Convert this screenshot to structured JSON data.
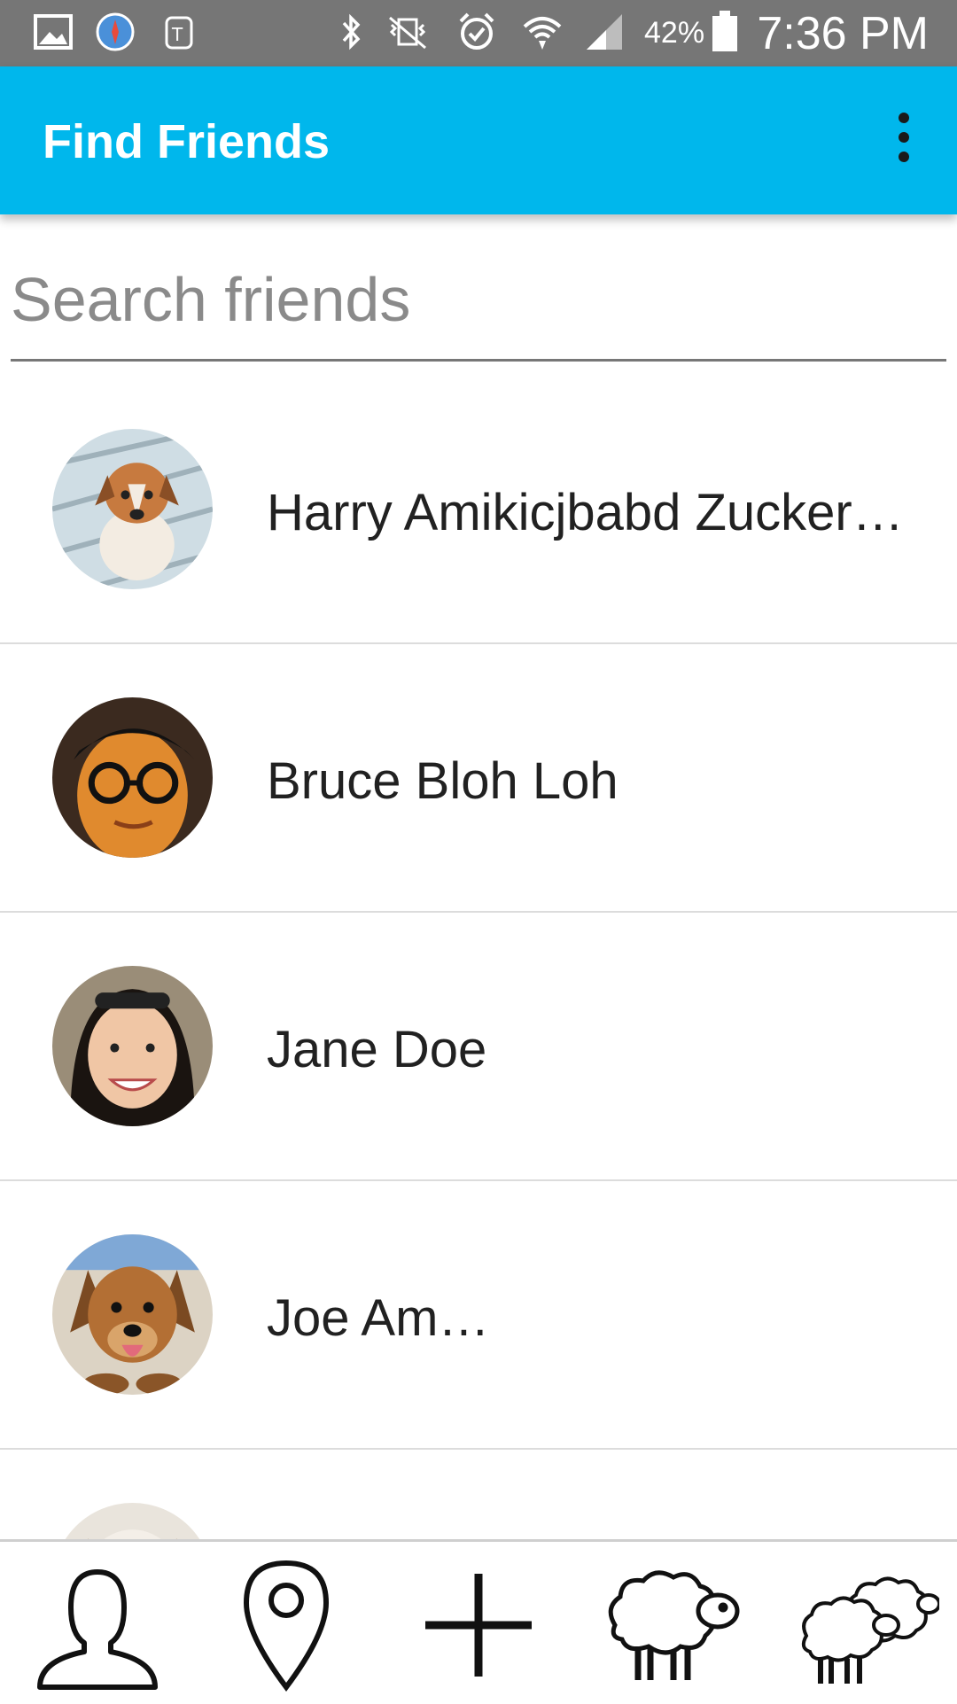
{
  "status_bar": {
    "battery_percent": "42%",
    "time": "7:36 PM",
    "icons": [
      "gallery-icon",
      "compass-icon",
      "tmobile-icon",
      "bluetooth-icon",
      "vibrate-icon",
      "alarm-icon",
      "wifi-icon",
      "signal-icon",
      "battery-icon"
    ]
  },
  "app_bar": {
    "title": "Find Friends",
    "menu_icon": "overflow-menu-icon"
  },
  "search": {
    "placeholder": "Search friends",
    "value": ""
  },
  "friends": [
    {
      "name": "Harry Amikicjbabd Zuckerman",
      "avatar": "puppy-corgi"
    },
    {
      "name": "Bruce Bloh Loh",
      "avatar": "man-glasses"
    },
    {
      "name": "Jane Doe",
      "avatar": "woman-sunglasses"
    },
    {
      "name": "Joe Am…",
      "avatar": "puppy-brown"
    },
    {
      "name": "",
      "avatar": "dog-white"
    }
  ],
  "bottom_nav": {
    "items": [
      "profile-icon",
      "location-pin-icon",
      "add-icon",
      "sheep-icon",
      "flock-icon"
    ]
  },
  "colors": {
    "app_bar": "#00b7ec",
    "status_bar": "#767676",
    "divider": "#dcdcdc"
  }
}
